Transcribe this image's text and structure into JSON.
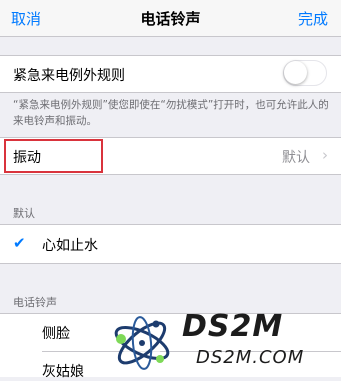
{
  "nav": {
    "cancel": "取消",
    "title": "电话铃声",
    "done": "完成"
  },
  "emergency": {
    "label": "紧急来电例外规则",
    "toggle_on": false,
    "footnote": "“紧急来电例外规则”使您即使在“勿扰模式”打开时，也可允许此人的来电铃声和振动。"
  },
  "vibration": {
    "label": "振动",
    "value": "默认"
  },
  "default_section": {
    "header": "默认",
    "items": [
      {
        "label": "心如止水",
        "checked": true
      }
    ]
  },
  "ringtone_section": {
    "header": "电话铃声",
    "items": [
      {
        "label": "侧脸"
      },
      {
        "label": "灰姑娘"
      }
    ]
  },
  "watermark": {
    "logo": "DS2M",
    "domain": "DS2M.COM"
  },
  "colors": {
    "accent": "#007aff",
    "highlight": "#d9333c"
  }
}
